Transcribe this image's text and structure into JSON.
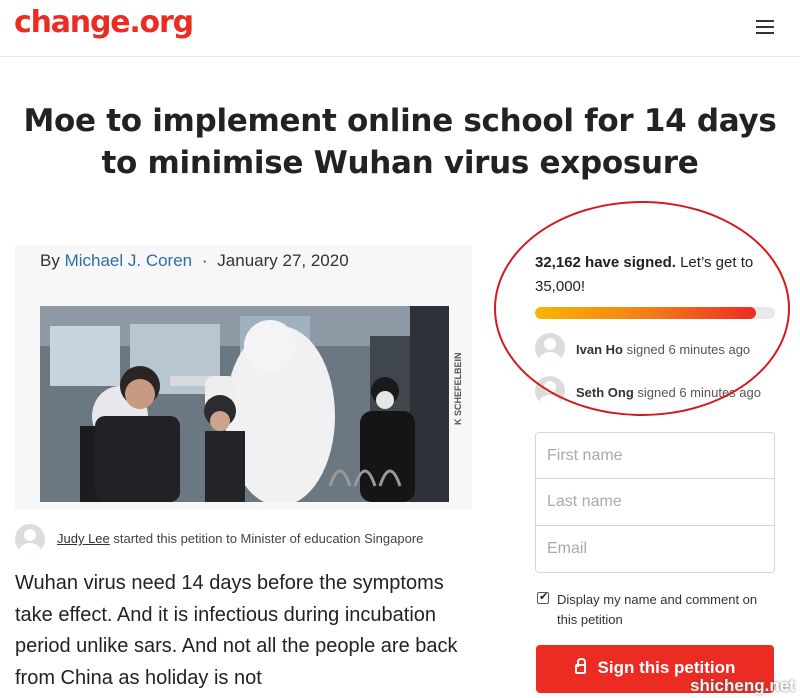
{
  "header": {
    "logo": "change.org",
    "menu_icon": "hamburger-menu-icon"
  },
  "petition": {
    "title": "Moe to implement online school for 14 days to minimise Wuhan virus exposure"
  },
  "story": {
    "by_prefix": "By",
    "author": "Michael J. Coren",
    "separator": "·",
    "date": "January 27, 2020",
    "photo_credit": "K SCHEFELBEIN"
  },
  "starter": {
    "name": "Judy Lee",
    "text": " started this petition to Minister of education Singapore"
  },
  "body": {
    "text": "Wuhan virus need 14 days before the symptoms take effect. And it is infectious during incubation period unlike sars. And not all the people are back from China as holiday is not"
  },
  "signatures": {
    "count_text": "32,162 have signed.",
    "goal_text": " Let’s get to 35,000!",
    "progress_fraction": 0.92,
    "recent": [
      {
        "name": "Ivan Ho",
        "action": " signed 6 minutes ago"
      },
      {
        "name": "Seth Ong",
        "action": " signed 6 minutes ago"
      }
    ]
  },
  "form": {
    "first_name_placeholder": "First name",
    "last_name_placeholder": "Last name",
    "email_placeholder": "Email",
    "display_label": "Display my name and comment on this petition",
    "display_checked": true,
    "submit_label": "Sign this petition"
  },
  "watermarks": {
    "left": "",
    "right": "shicheng.net"
  },
  "colors": {
    "brand": "#ec2c22",
    "link": "#2a6fa8",
    "annotation_circle": "#d4191d"
  }
}
